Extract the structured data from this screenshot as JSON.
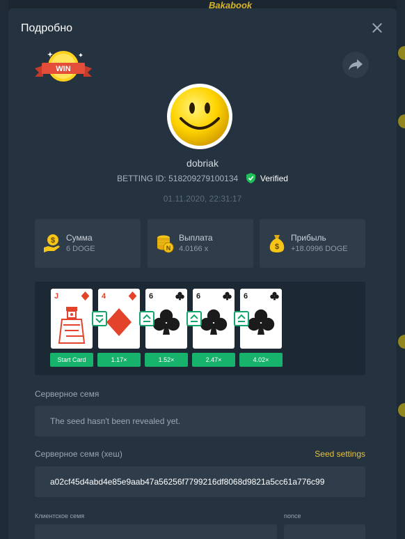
{
  "modal": {
    "title": "Подробно",
    "badge_text": "WIN"
  },
  "player": {
    "username": "dobriak",
    "betting_id_label": "BETTING ID:",
    "betting_id": "518209279100134",
    "verified_label": "Verified",
    "datetime": "01.11.2020, 22:31:17"
  },
  "stats": {
    "amount": {
      "label": "Сумма",
      "value": "6 DOGE",
      "icon": "dollar-hand-icon"
    },
    "payout": {
      "label": "Выплата",
      "value": "4.0166 x",
      "icon": "coins-stack-icon"
    },
    "profit": {
      "label": "Прибыль",
      "value": "+18.0996 DOGE",
      "icon": "money-bag-icon"
    }
  },
  "cards": [
    {
      "rank": "J",
      "suit": "diamonds",
      "color": "#e2432a",
      "step": "Start Card"
    },
    {
      "rank": "4",
      "suit": "diamonds",
      "color": "#e2432a",
      "step": "1.17×",
      "guess": "lower"
    },
    {
      "rank": "6",
      "suit": "clubs",
      "color": "#1b1b1b",
      "step": "1.52×",
      "guess": "higher"
    },
    {
      "rank": "6",
      "suit": "clubs",
      "color": "#1b1b1b",
      "step": "2.47×",
      "guess": "higher"
    },
    {
      "rank": "6",
      "suit": "clubs",
      "color": "#1b1b1b",
      "step": "4.02×",
      "guess": "higher"
    }
  ],
  "seeds": {
    "server_seed_label": "Серверное семя",
    "server_seed_value": "The seed hasn't been revealed yet.",
    "server_hash_label": "Серверное семя (хеш)",
    "seed_settings_label": "Seed settings",
    "server_hash_value": "a02cf45d4abd4e85e9aab47a56256f7799216df8068d9821a5cc61a776c99",
    "client_seed_label": "Клиентское семя",
    "nonce_label": "nonce"
  },
  "background": {
    "brand_text": "Bakabook"
  },
  "colors": {
    "accent_green": "#17b26b",
    "accent_yellow": "#e8c340",
    "modal_bg": "#25323f",
    "card_bg": "#2f3d4b"
  }
}
